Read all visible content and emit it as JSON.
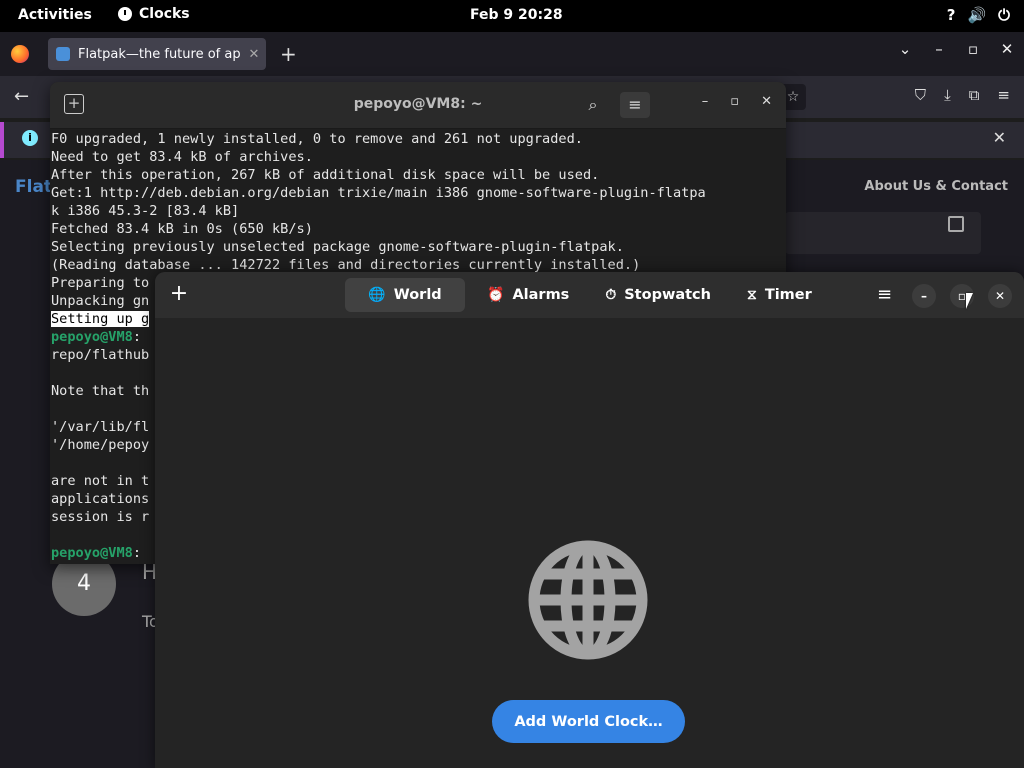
{
  "topbar": {
    "activities": "Activities",
    "app_name": "Clocks",
    "datetime": "Feb 9  20:28",
    "tray": [
      "?",
      "🔊",
      "⏻"
    ]
  },
  "firefox": {
    "tab_title": "Flatpak—the future of ap",
    "tab_close": "✕",
    "new_tab": "+",
    "controls": [
      "⌄",
      "–",
      "▫",
      "✕"
    ],
    "back": "←",
    "bookmark_star": "☆",
    "toolbar_icons": [
      "⛉",
      "⤓",
      "⧉",
      "≡"
    ],
    "banner_info": "i",
    "banner_close": "✕",
    "brand": "Flat",
    "about": "About Us & Contact",
    "step_number": "4",
    "heading_fragment": "H",
    "text_fragment": "To"
  },
  "terminal": {
    "title": "pepoyo@VM8: ~",
    "new_tab": "+",
    "search": "⌕",
    "menu": "≡",
    "controls": [
      "–",
      "▫",
      "✕"
    ],
    "lines": [
      {
        "text": "F0 upgraded, 1 newly installed, 0 to remove and 261 not upgraded."
      },
      {
        "text": "Need to get 83.4 kB of archives."
      },
      {
        "text": "After this operation, 267 kB of additional disk space will be used."
      },
      {
        "text": "Get:1 http://deb.debian.org/debian trixie/main i386 gnome-software-plugin-flatpa"
      },
      {
        "text": "k i386 45.3-2 [83.4 kB]"
      },
      {
        "text": "Fetched 83.4 kB in 0s (650 kB/s)"
      },
      {
        "text": "Selecting previously unselected package gnome-software-plugin-flatpak."
      },
      {
        "text": "(Reading database ... 142722 files and directories currently installed.)"
      },
      {
        "text": "Preparing to"
      },
      {
        "text": "Unpacking gn"
      },
      {
        "text": "Setting up g"
      },
      {
        "prompt": "pepoyo@VM8",
        "text": ":"
      },
      {
        "text": "repo/flathub"
      },
      {
        "text": ""
      },
      {
        "text": "Note that th"
      },
      {
        "text": ""
      },
      {
        "text": "'/var/lib/fl"
      },
      {
        "text": "'/home/pepoy"
      },
      {
        "text": ""
      },
      {
        "text": "are not in t"
      },
      {
        "text": "applications"
      },
      {
        "text": "session is r"
      },
      {
        "text": ""
      },
      {
        "prompt": "pepoyo@VM8",
        "text": ":"
      }
    ]
  },
  "clocks": {
    "add": "+",
    "tabs": [
      {
        "label": "World",
        "icon": "🌐",
        "active": true
      },
      {
        "label": "Alarms",
        "icon": "⏰",
        "active": false
      },
      {
        "label": "Stopwatch",
        "icon": "⏱",
        "active": false
      },
      {
        "label": "Timer",
        "icon": "⧖",
        "active": false
      }
    ],
    "menu": "≡",
    "window_controls": [
      "–",
      "▫",
      "✕"
    ],
    "add_world_clock": "Add World Clock…",
    "colors": {
      "accent": "#3584e4",
      "globe": "#a3a3a3"
    }
  }
}
